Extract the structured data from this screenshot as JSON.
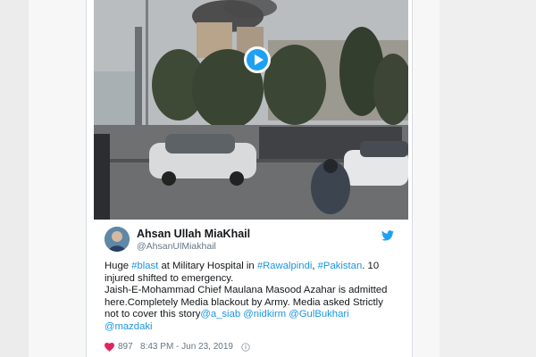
{
  "tweet": {
    "author_name": "Ahsan Ullah MiaKhail",
    "handle": "@AhsanUlMiakhail",
    "line1_a": "Huge ",
    "line1_tag_blast": "#blast",
    "line1_b": " at Military Hospital in ",
    "line1_tag_rawalpindi": "#Rawalpindi",
    "line1_c": ", ",
    "line1_tag_pakistan": "#Pakistan",
    "line1_d": ". 10 injured shifted to emergency.",
    "line2": "Jaish-E-Mohammad Chief Maulana Masood Azahar is admitted here.Completely Media blackout by Army. Media asked Strictly not to cover this story",
    "mention_1": "@a_siab",
    "mention_2": "@nidkirm",
    "mention_3": "@GulBukhari",
    "mention_4": "@mazdaki",
    "likes": "897",
    "timestamp": "8:43 PM - Jun 23, 2019"
  },
  "colors": {
    "link": "#1b95e0",
    "play_button": "#1da1f2",
    "muted_text": "#657786"
  },
  "icons": {
    "play": "play-icon",
    "bird": "twitter-bird-icon",
    "like": "heart-icon",
    "info": "info-icon"
  }
}
